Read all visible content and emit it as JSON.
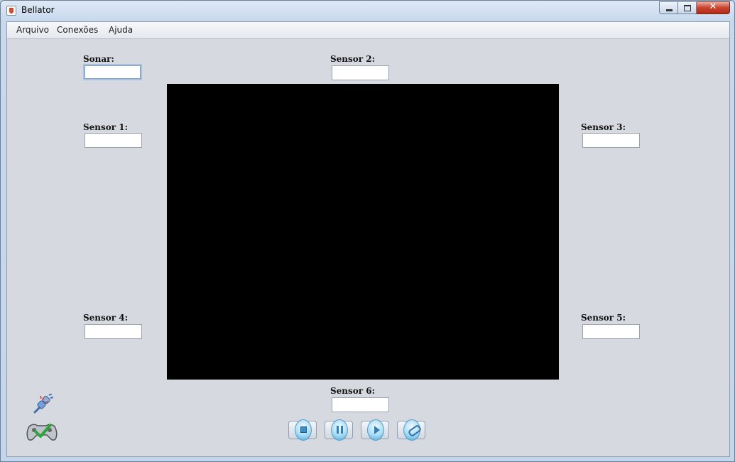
{
  "window": {
    "title": "Bellator"
  },
  "menu": {
    "items": [
      "Arquivo",
      "Conexões",
      "Ajuda"
    ]
  },
  "sensors": {
    "sonar": {
      "label": "Sonar:",
      "value": ""
    },
    "s1": {
      "label": "Sensor 1:",
      "value": ""
    },
    "s2": {
      "label": "Sensor 2:",
      "value": ""
    },
    "s3": {
      "label": "Sensor 3:",
      "value": ""
    },
    "s4": {
      "label": "Sensor 4:",
      "value": ""
    },
    "s5": {
      "label": "Sensor 5:",
      "value": ""
    },
    "s6": {
      "label": "Sensor 6:",
      "value": ""
    }
  },
  "controls": {
    "icons": [
      "stop-icon",
      "pause-icon",
      "play-icon",
      "connect-link-icon"
    ]
  },
  "side_icons": [
    "disconnected-plug-icon",
    "gamepad-check-icon"
  ],
  "colors": {
    "display_background": "#000000",
    "accent": "#4aa7d8"
  }
}
